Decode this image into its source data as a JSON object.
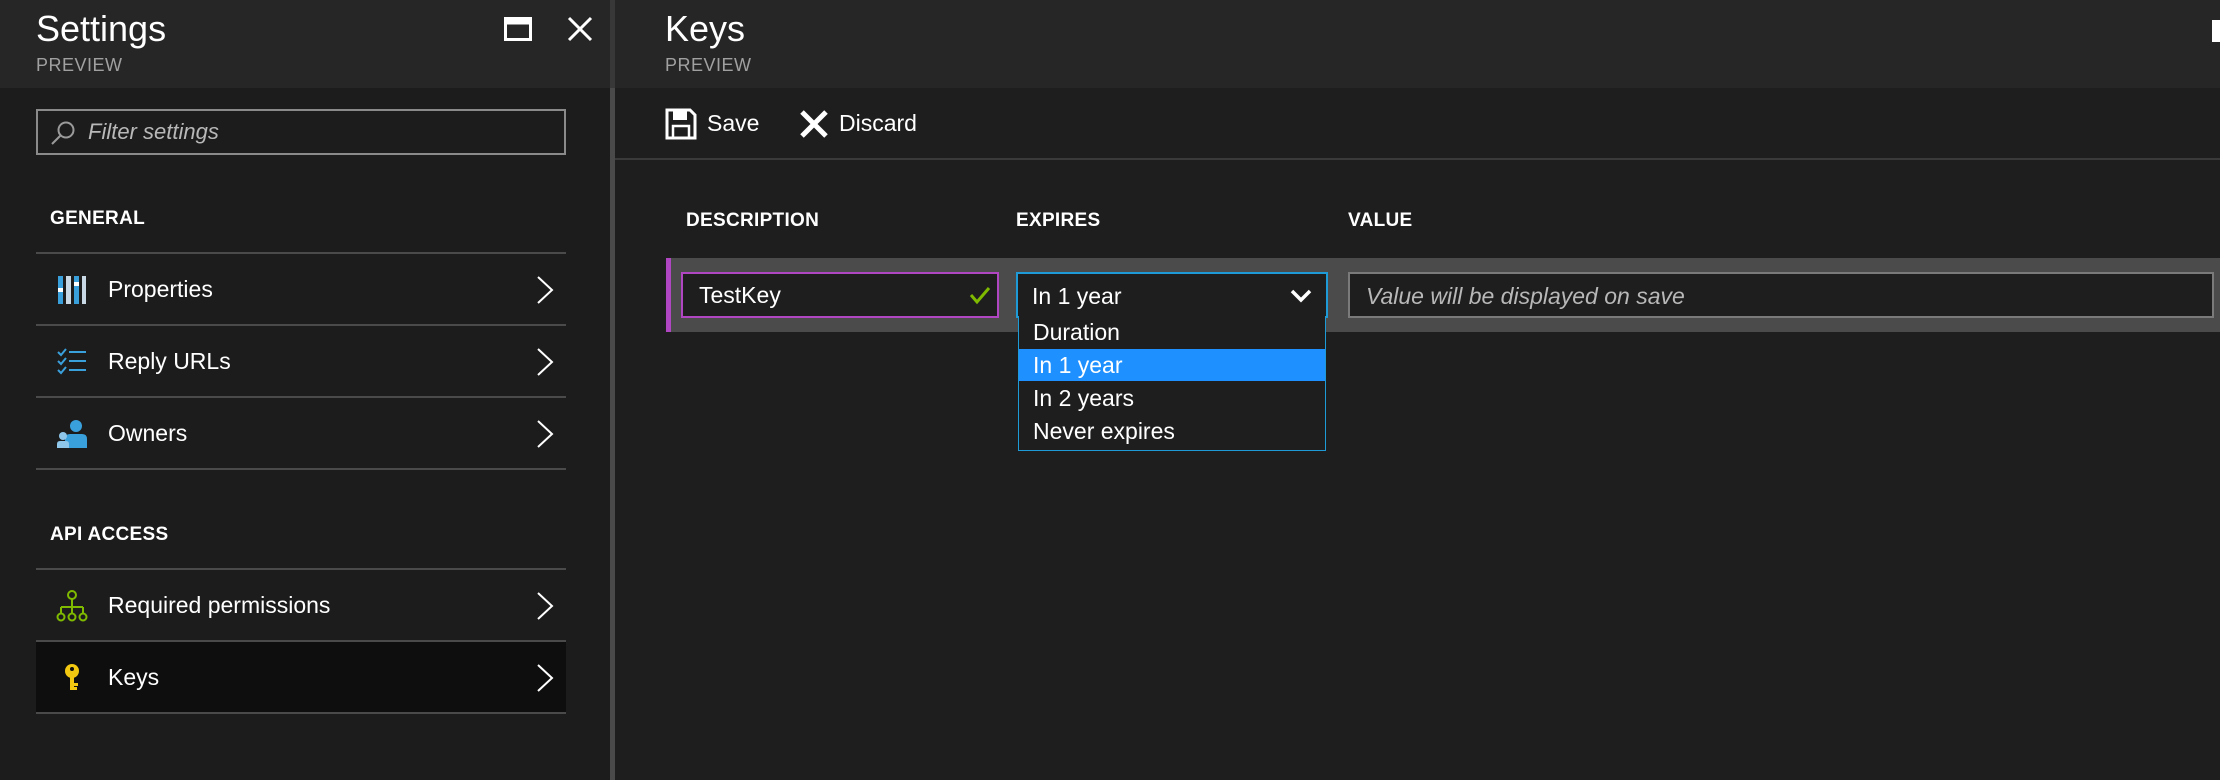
{
  "settings_blade": {
    "title": "Settings",
    "subtitle": "PREVIEW",
    "filter": {
      "placeholder": "Filter settings",
      "value": ""
    },
    "sections": [
      {
        "heading": "GENERAL",
        "items": [
          {
            "label": "Properties",
            "icon": "properties-icon"
          },
          {
            "label": "Reply URLs",
            "icon": "list-check-icon"
          },
          {
            "label": "Owners",
            "icon": "people-icon"
          }
        ]
      },
      {
        "heading": "API ACCESS",
        "items": [
          {
            "label": "Required permissions",
            "icon": "hierarchy-icon"
          },
          {
            "label": "Keys",
            "icon": "key-icon",
            "active": true
          }
        ]
      }
    ]
  },
  "keys_blade": {
    "title": "Keys",
    "subtitle": "PREVIEW",
    "toolbar": {
      "save_label": "Save",
      "discard_label": "Discard"
    },
    "columns": {
      "description": "DESCRIPTION",
      "expires": "EXPIRES",
      "value": "VALUE"
    },
    "row": {
      "description": "TestKey",
      "expires_selected": "In 1 year",
      "value_placeholder": "Value will be displayed on save"
    },
    "expires_options": [
      "Duration",
      "In 1 year",
      "In 2 years",
      "Never expires"
    ],
    "expires_selected_index": 1
  },
  "colors": {
    "accent_purple": "#b146c2",
    "selected_blue": "#1e90ff",
    "focus_border": "#1e9bd6",
    "valid_green": "#7fba00",
    "key_yellow": "#f2c811",
    "icon_blue": "#3aa0dc"
  }
}
